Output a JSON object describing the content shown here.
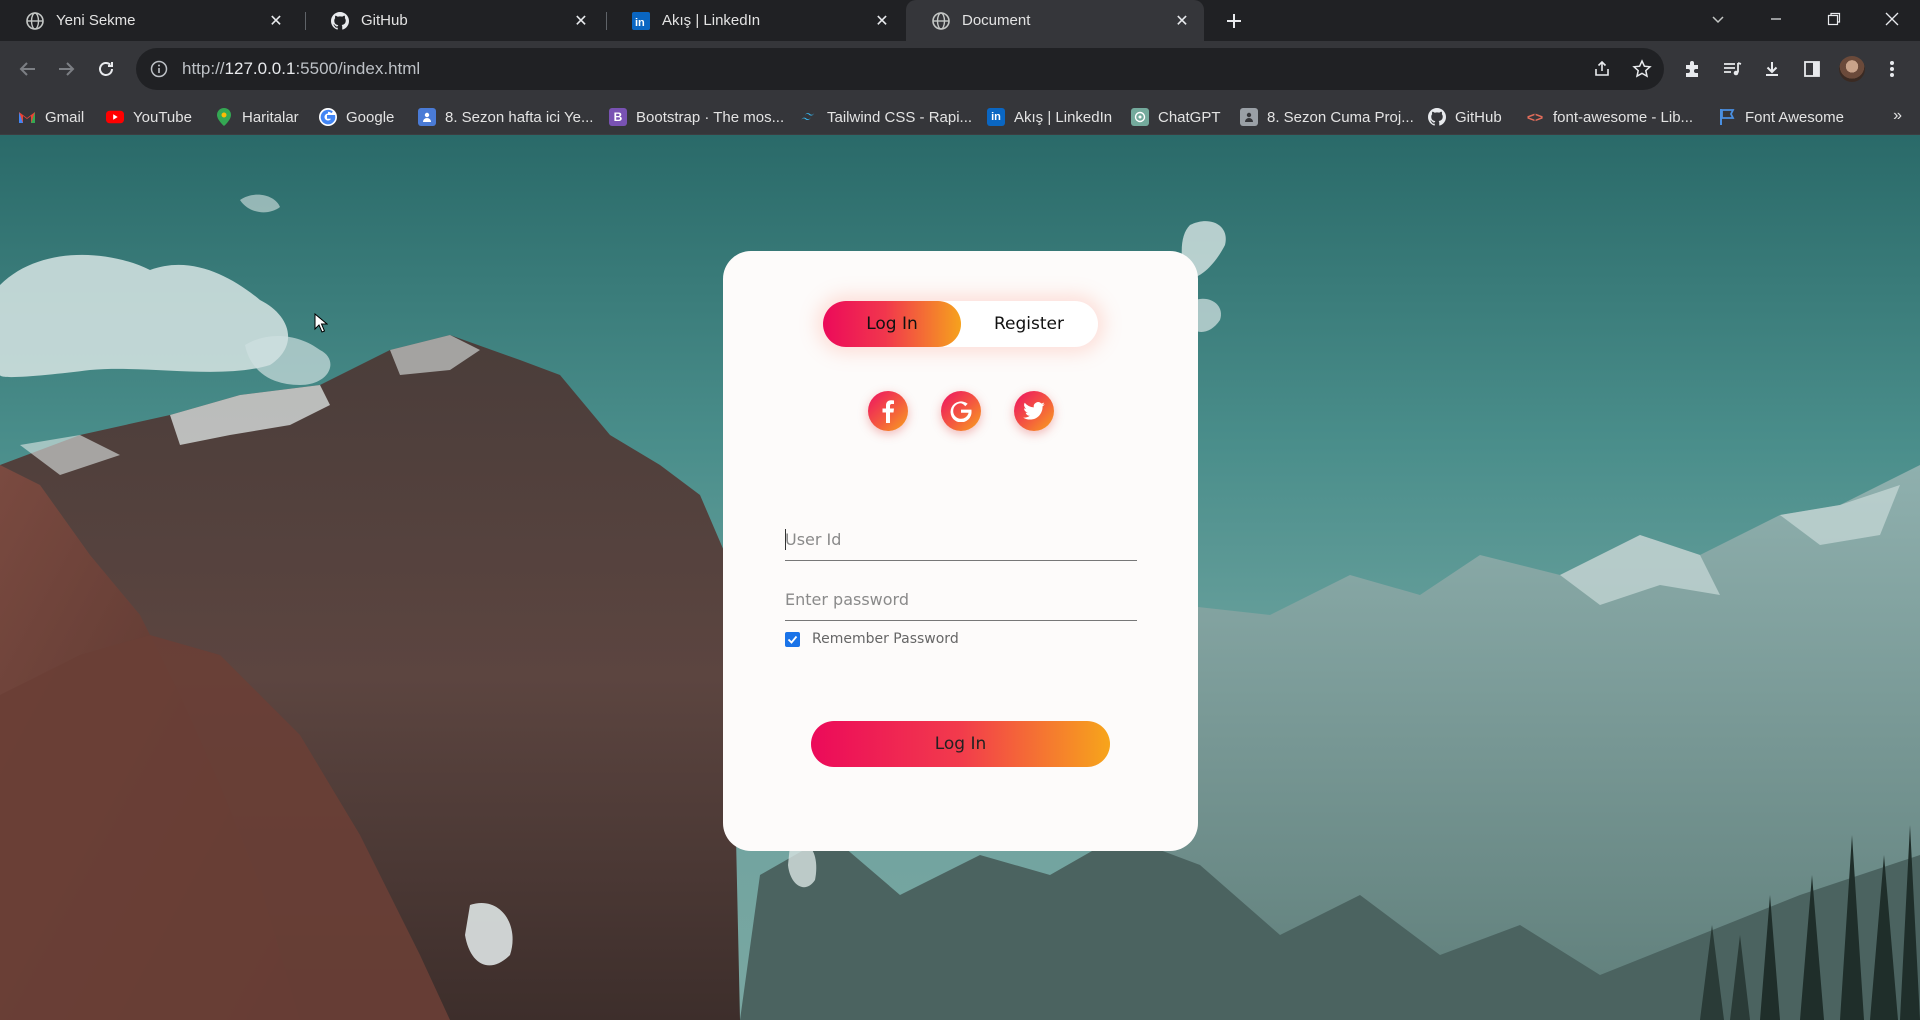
{
  "browser": {
    "tabs": [
      {
        "title": "Yeni Sekme",
        "icon": "globe-icon",
        "active": false
      },
      {
        "title": "GitHub",
        "icon": "github-icon",
        "active": false
      },
      {
        "title": "Akış | LinkedIn",
        "icon": "linkedin-icon",
        "active": false
      },
      {
        "title": "Document",
        "icon": "globe-icon",
        "active": true
      }
    ],
    "address": {
      "prefix": "http://",
      "host": "127.0.0.1",
      "rest": ":5500/index.html"
    },
    "bookmarks": [
      {
        "label": "Gmail",
        "icon": "gmail-icon",
        "color": "#ea4335"
      },
      {
        "label": "YouTube",
        "icon": "youtube-icon",
        "color": "#ff0000"
      },
      {
        "label": "Haritalar",
        "icon": "maps-icon",
        "color": "#34a853"
      },
      {
        "label": "Google",
        "icon": "google-icon",
        "color": "#4285f4"
      },
      {
        "label": "8. Sezon hafta ici Ye...",
        "icon": "classroom-icon",
        "color": "#4a7bd6"
      },
      {
        "label": "Bootstrap · The mos...",
        "icon": "bootstrap-icon",
        "color": "#7952b3"
      },
      {
        "label": "Tailwind CSS - Rapi...",
        "icon": "tailwind-icon",
        "color": "#38bdf8"
      },
      {
        "label": "Akış | LinkedIn",
        "icon": "linkedin-icon",
        "color": "#0a66c2"
      },
      {
        "label": "ChatGPT",
        "icon": "chatgpt-icon",
        "color": "#74aa9c"
      },
      {
        "label": "8. Sezon Cuma Proj...",
        "icon": "classroom-icon",
        "color": "#9aa0a6"
      },
      {
        "label": "GitHub",
        "icon": "github-icon",
        "color": "#ffffff"
      },
      {
        "label": "font-awesome - Lib...",
        "icon": "code-icon",
        "color": "#e06c5a"
      },
      {
        "label": "Font Awesome",
        "icon": "flag-icon",
        "color": "#4a90e2"
      }
    ]
  },
  "page": {
    "toggle": {
      "login": "Log In",
      "register": "Register",
      "active": "login"
    },
    "social": [
      "facebook-icon",
      "google-icon",
      "twitter-icon"
    ],
    "userid": {
      "placeholder": "User Id",
      "value": ""
    },
    "password": {
      "placeholder": "Enter password",
      "value": ""
    },
    "remember": {
      "label": "Remember Password",
      "checked": true
    },
    "submit_label": "Log In",
    "accent_start": "#ec0a5a",
    "accent_end": "#f7a51b"
  }
}
